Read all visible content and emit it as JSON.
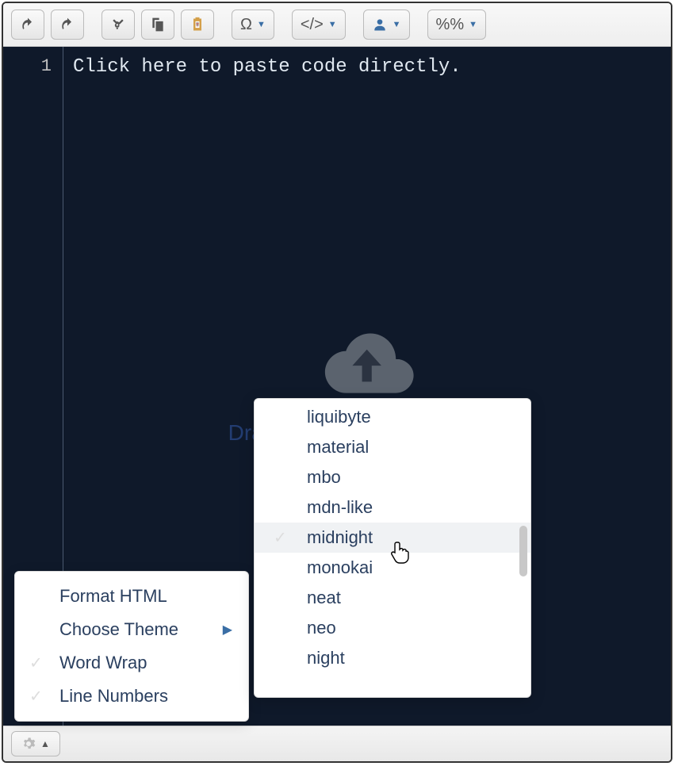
{
  "toolbar": {
    "omega": "Ω",
    "code": "</>",
    "percent": "%%"
  },
  "editor": {
    "line_number": "1",
    "placeholder": "Click here to paste code directly.",
    "dropzone_text": "Drag text or HTML files here"
  },
  "settings_menu": {
    "items": [
      {
        "label": "Format HTML",
        "check": false,
        "submenu": false
      },
      {
        "label": "Choose Theme",
        "check": false,
        "submenu": true
      },
      {
        "label": "Word Wrap",
        "check": true,
        "submenu": false
      },
      {
        "label": "Line Numbers",
        "check": true,
        "submenu": false
      }
    ]
  },
  "theme_menu": {
    "items": [
      "liquibyte",
      "material",
      "mbo",
      "mdn-like",
      "midnight",
      "monokai",
      "neat",
      "neo",
      "night"
    ],
    "selected_index": 4
  }
}
